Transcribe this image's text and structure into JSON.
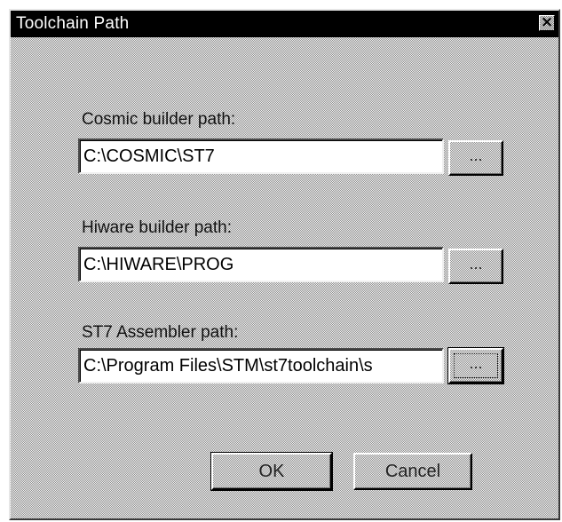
{
  "dialog": {
    "title": "Toolchain Path",
    "close_icon": "close-x-icon"
  },
  "cosmic": {
    "label": "Cosmic builder path:",
    "value": "C:\\COSMIC\\ST7",
    "browse_label": "..."
  },
  "hiware": {
    "label": "Hiware builder path:",
    "value": "C:\\HIWARE\\PROG",
    "browse_label": "..."
  },
  "st7asm": {
    "label": "ST7 Assembler path:",
    "value": "C:\\Program Files\\STM\\st7toolchain\\s",
    "browse_label": "..."
  },
  "buttons": {
    "ok": "OK",
    "cancel": "Cancel"
  }
}
